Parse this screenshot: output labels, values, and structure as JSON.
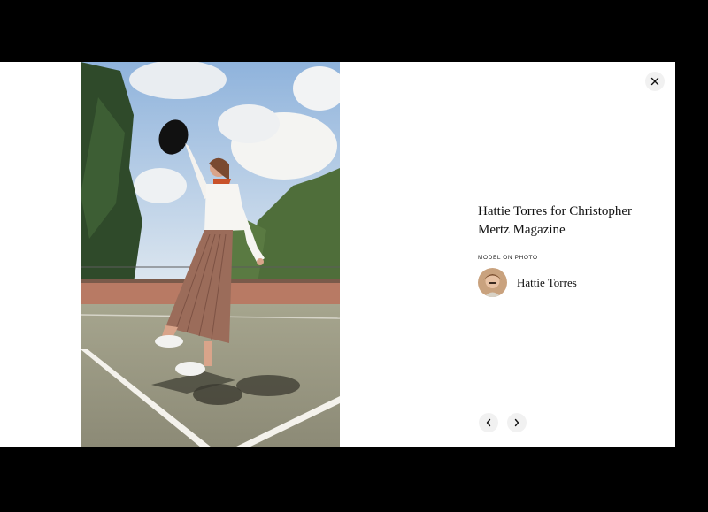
{
  "modal": {
    "photo": {
      "description_icon": "fashion-photo-image"
    },
    "close_icon": "close-icon",
    "title": "Hattie Torres for Christopher Mertz Magazine",
    "model_label": "MODEL ON PHOTO",
    "model": {
      "name": "Hattie Torres",
      "avatar_icon": "model-avatar"
    },
    "nav": {
      "prev_icon": "chevron-left-icon",
      "next_icon": "chevron-right-icon"
    }
  },
  "colors": {
    "backdrop": "#000000",
    "modal_bg": "#ffffff",
    "button_bg": "#f1f1f1",
    "text": "#111111"
  }
}
